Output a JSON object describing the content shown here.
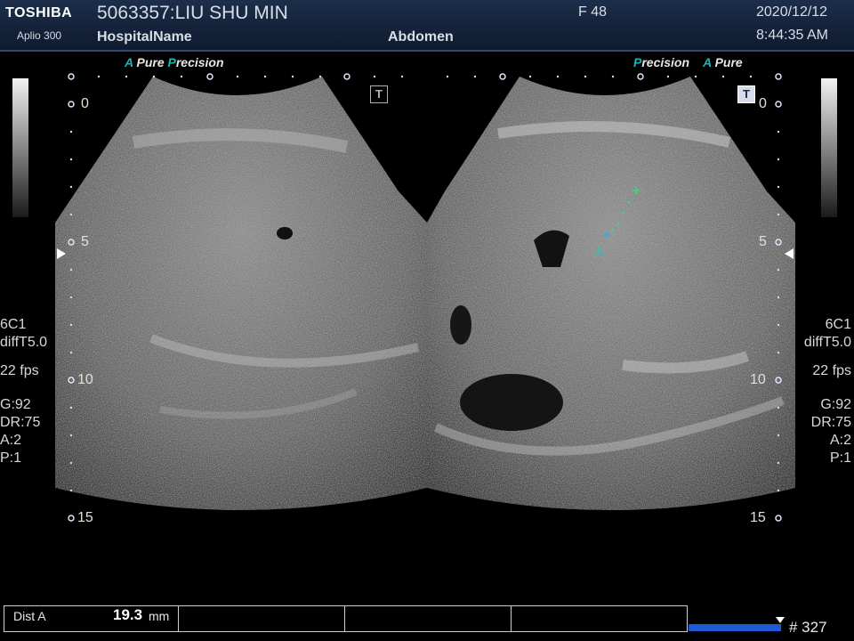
{
  "header": {
    "brand": "TOSHIBA",
    "model": "Aplio 300",
    "patient": "5063357:LIU SHU MIN",
    "hospital": "HospitalName",
    "sex_age": "F 48",
    "exam": "Abdomen",
    "date": "2020/12/12",
    "time": "8:44:35 AM"
  },
  "left_tag": {
    "a": "A",
    "pure": "Pure",
    "p": "P",
    "precision": "recision"
  },
  "right_tag": {
    "p": "P",
    "precision": "recision",
    "a": "A",
    "pure": "Pure"
  },
  "params": {
    "probe": "6C1",
    "mode": "diffT5.0",
    "fps": "22 fps",
    "gain": "G:92",
    "dr": "DR:75",
    "a": "A:2",
    "p": "P:1"
  },
  "depth_labels": [
    "0",
    "5",
    "10",
    "15"
  ],
  "t_icon": "T",
  "caliper_label": "A",
  "measurement": {
    "label": "Dist A",
    "value": "19.3",
    "unit": "mm"
  },
  "frame_counter": "# 327",
  "colors": {
    "accent": "#1fb3b3",
    "header_bg": "#14233c",
    "cine": "#1c5ad6",
    "caliper": "#24c4c4"
  }
}
